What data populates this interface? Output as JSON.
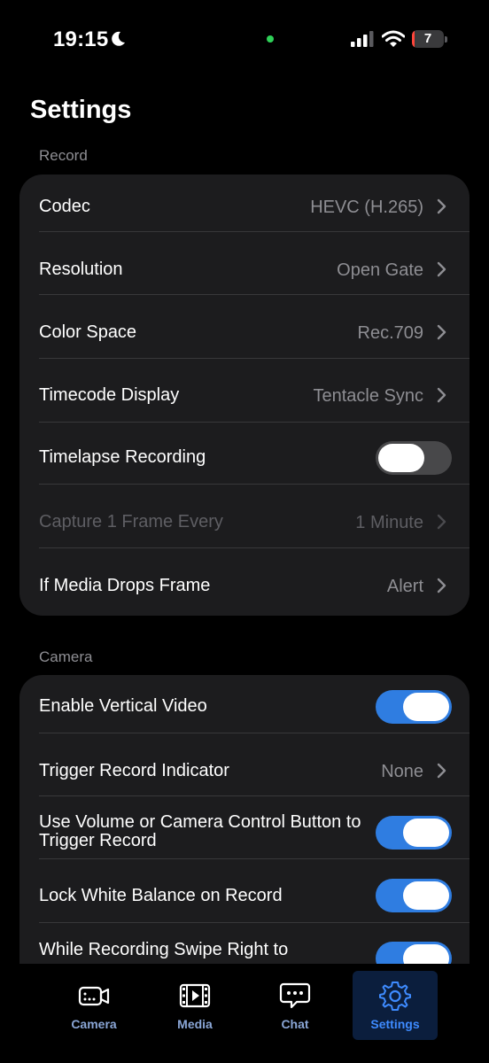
{
  "status_bar": {
    "time": "19:15",
    "battery_level": "7",
    "battery_fraction": 0.07,
    "colors": {
      "battery_low": "#ff453a",
      "activity_dot": "#2fd158"
    },
    "icons": [
      "moon-icon",
      "cellular-signal-icon",
      "wifi-icon",
      "battery-icon"
    ]
  },
  "page": {
    "title": "Settings"
  },
  "record_section": {
    "label": "Record",
    "rows": [
      {
        "label": "Codec",
        "value": "HEVC (H.265)"
      },
      {
        "label": "Resolution",
        "value": "Open Gate"
      },
      {
        "label": "Color Space",
        "value": "Rec.709"
      },
      {
        "label": "Timecode Display",
        "value": "Tentacle Sync"
      },
      {
        "label": "Timelapse Recording",
        "toggle": "off"
      },
      {
        "label": "Capture 1 Frame Every",
        "value": "1 Minute",
        "disabled": true
      },
      {
        "label": "If Media Drops Frame",
        "value": "Alert"
      }
    ]
  },
  "camera_section": {
    "label": "Camera",
    "rows": [
      {
        "label": "Enable Vertical Video",
        "toggle": "on"
      },
      {
        "label": "Trigger Record Indicator",
        "value": "None"
      },
      {
        "label": "Use Volume or Camera Control Button to Trigger Record",
        "toggle": "on"
      },
      {
        "label": "Lock White Balance on Record",
        "toggle": "on"
      },
      {
        "label": "While Recording Swipe Right to",
        "toggle": "on"
      }
    ]
  },
  "tab_bar": {
    "tabs": [
      {
        "label": "Camera",
        "icon": "camera-icon"
      },
      {
        "label": "Media",
        "icon": "film-icon"
      },
      {
        "label": "Chat",
        "icon": "chat-bubble-icon"
      },
      {
        "label": "Settings",
        "icon": "gear-icon",
        "active": true
      }
    ]
  },
  "colors": {
    "accent": "#2f7de1",
    "background": "#000000",
    "group_background": "#1c1c1e",
    "secondary_text": "#8e8e93"
  }
}
